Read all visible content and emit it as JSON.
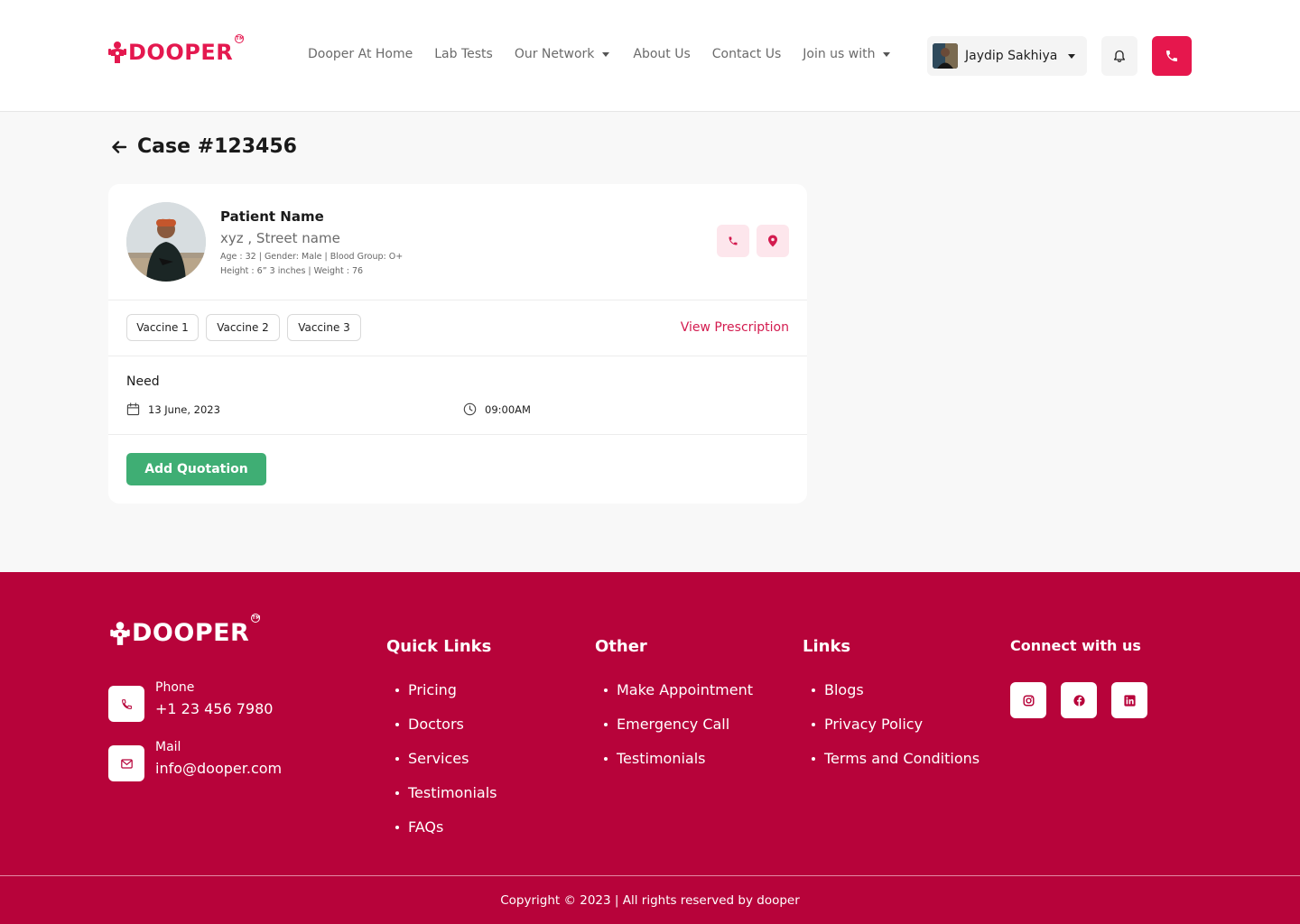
{
  "brand": {
    "name": "DOOPER",
    "tm": "TM",
    "color": "#e4184f"
  },
  "nav": {
    "items": [
      {
        "label": "Dooper At Home",
        "dropdown": false
      },
      {
        "label": "Lab Tests",
        "dropdown": false
      },
      {
        "label": "Our Network",
        "dropdown": true
      },
      {
        "label": "About Us",
        "dropdown": false
      },
      {
        "label": "Contact Us",
        "dropdown": false
      },
      {
        "label": "Join us with",
        "dropdown": true
      }
    ],
    "user_name": "Jaydip Sakhiya",
    "icons": {
      "bell": "bell-icon",
      "call": "phone-icon"
    }
  },
  "page": {
    "title": "Case #123456",
    "back_icon": "arrow-left-icon"
  },
  "patient": {
    "name": "Patient Name",
    "address": "xyz , Street name",
    "meta_line1": "Age : 32 | Gender: Male | Blood Group: O+",
    "meta_line2": "Height : 6” 3 inches | Weight : 76"
  },
  "vaccines": [
    "Vaccine 1",
    "Vaccine 2",
    "Vaccine 3"
  ],
  "view_prescription": "View Prescription",
  "need": {
    "label": "Need",
    "date": "13 June, 2023",
    "time": "09:00AM"
  },
  "actions": {
    "add_quotation": "Add Quotation",
    "add_quotation_color": "#3fae74"
  },
  "footer": {
    "bg_color": "#b7033a",
    "phone_label": "Phone",
    "phone_value": "+1 23 456 7980",
    "mail_label": "Mail",
    "mail_value": "info@dooper.com",
    "quick_links": {
      "title": "Quick Links",
      "items": [
        "Pricing",
        "Doctors",
        "Services",
        "Testimonials",
        "FAQs"
      ]
    },
    "other": {
      "title": "Other",
      "items": [
        "Make Appointment",
        "Emergency Call",
        "Testimonials"
      ]
    },
    "links": {
      "title": "Links",
      "items": [
        "Blogs",
        "Privacy Policy",
        "Terms and Conditions"
      ]
    },
    "connect": {
      "title": "Connect with us",
      "socials": [
        "instagram-icon",
        "facebook-icon",
        "linkedin-icon"
      ]
    },
    "copyright": "Copyright © 2023 | All rights reserved by dooper"
  }
}
